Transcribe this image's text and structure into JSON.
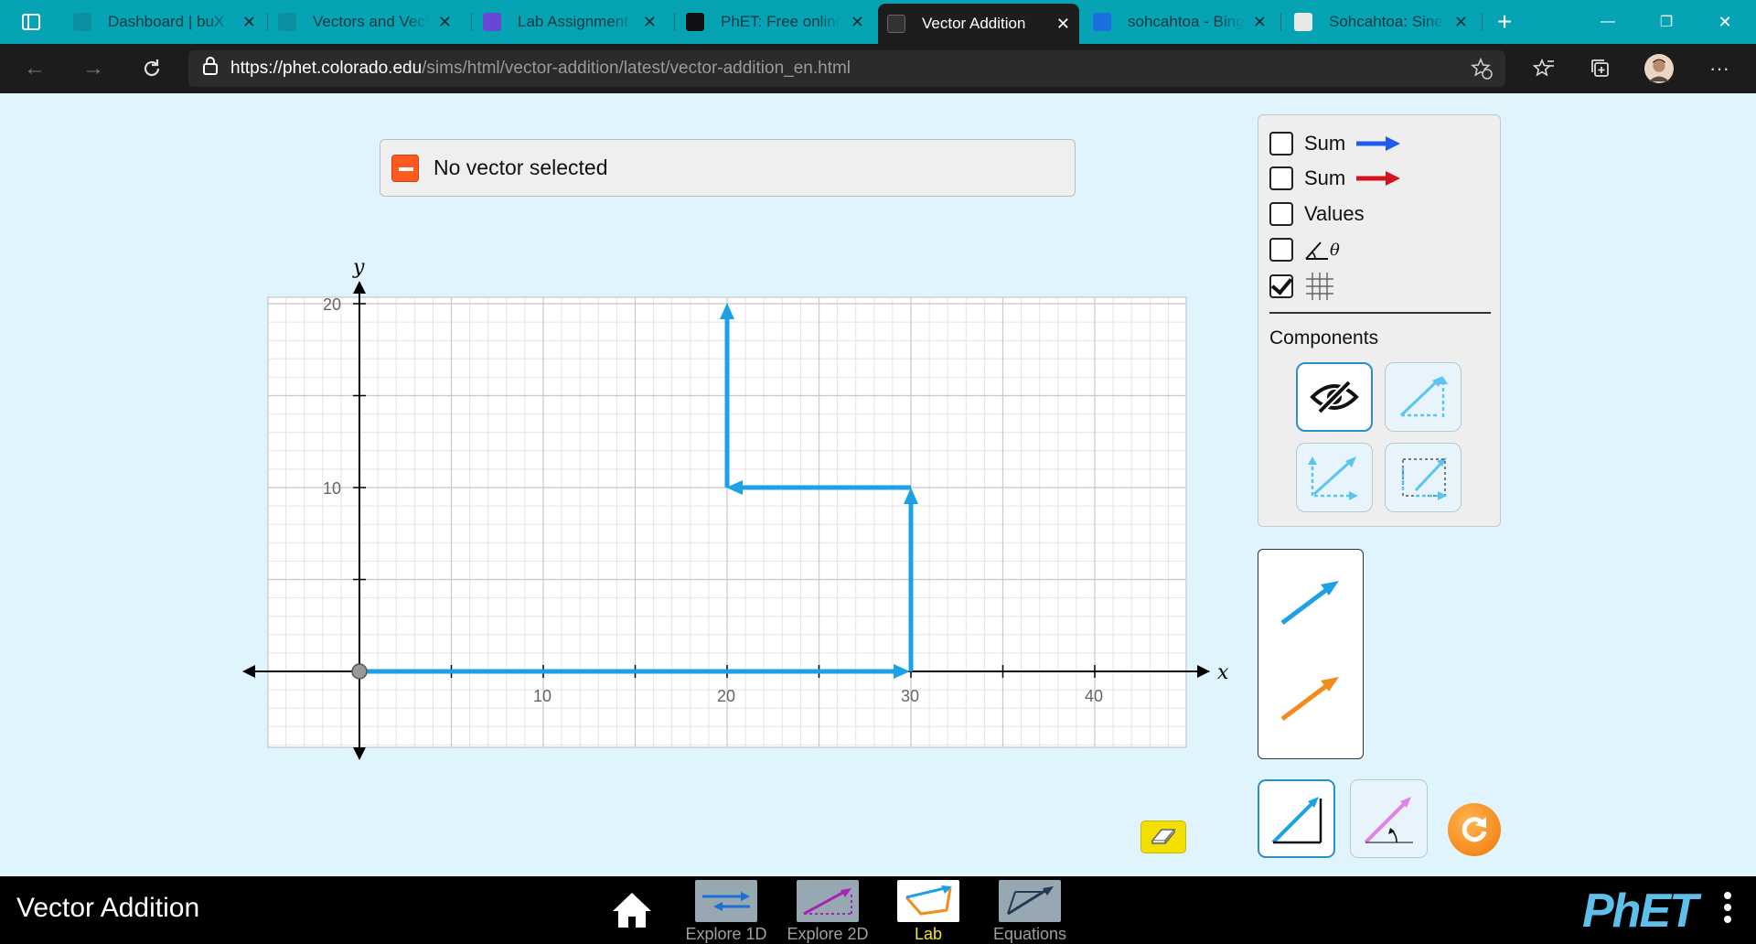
{
  "browser": {
    "tabs": [
      {
        "title": "Dashboard | buX",
        "close": "✕"
      },
      {
        "title": "Vectors and Vect",
        "close": "✕"
      },
      {
        "title": "Lab Assignment",
        "close": "✕"
      },
      {
        "title": "PhET: Free online",
        "close": "✕"
      },
      {
        "title": "Vector Addition",
        "close": "✕"
      },
      {
        "title": "sohcahtoa - Bing",
        "close": "✕"
      },
      {
        "title": "Sohcahtoa: Sine,",
        "close": "✕"
      }
    ],
    "new_tab_label": "+",
    "minimize": "—",
    "maximize": "❐",
    "close": "✕",
    "url_host": "https://phet.colorado.edu",
    "url_path": "/sims/html/vector-addition/latest/vector-addition_en.html"
  },
  "sim": {
    "readout": {
      "text": "No vector selected"
    },
    "graph": {
      "x_axis_label": "x",
      "y_axis_label": "y",
      "x_ticks": [
        "10",
        "20",
        "30",
        "40"
      ],
      "y_ticks": [
        "10",
        "20"
      ]
    },
    "controls": {
      "sum1_label": "Sum",
      "sum2_label": "Sum",
      "values_label": "Values",
      "angle_label": "θ",
      "components_title": "Components",
      "sum1_checked": false,
      "sum2_checked": false,
      "values_checked": false,
      "angle_checked": false,
      "grid_checked": true
    },
    "colors": {
      "vector_blue": "#1da1e6",
      "sum_blue": "#1f5af2",
      "sum_red": "#d2141c",
      "creator_orange": "#f28c1d",
      "eraser_yellow": "#f3df00"
    }
  },
  "navbar": {
    "title": "Vector Addition",
    "screens": [
      {
        "label": "Explore 1D",
        "active": false
      },
      {
        "label": "Explore 2D",
        "active": false
      },
      {
        "label": "Lab",
        "active": true
      },
      {
        "label": "Equations",
        "active": false
      }
    ],
    "logo": "PhET"
  }
}
